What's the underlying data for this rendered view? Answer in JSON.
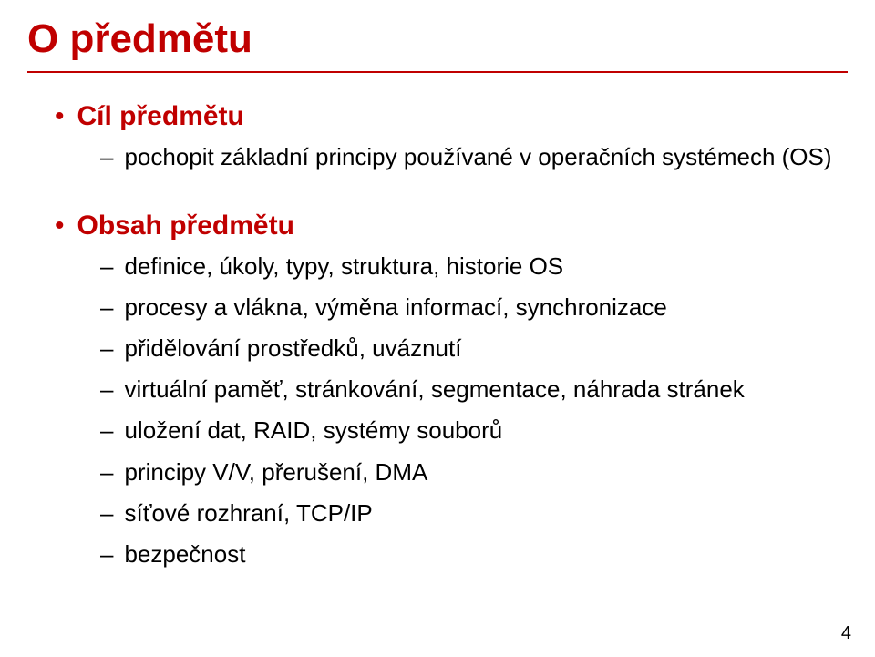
{
  "slide": {
    "title": "O předmětu",
    "sections": [
      {
        "heading": "Cíl předmětu",
        "items": [
          "pochopit základní principy používané v operačních systémech (OS)"
        ]
      },
      {
        "heading": "Obsah předmětu",
        "items": [
          "definice, úkoly, typy, struktura, historie OS",
          "procesy a vlákna, výměna informací, synchronizace",
          "přidělování prostředků, uváznutí",
          "virtuální paměť, stránkování, segmentace, náhrada stránek",
          "uložení dat, RAID, systémy souborů",
          "principy V/V, přerušení, DMA",
          "síťové rozhraní, TCP/IP",
          "bezpečnost"
        ]
      }
    ],
    "page_number": "4"
  }
}
